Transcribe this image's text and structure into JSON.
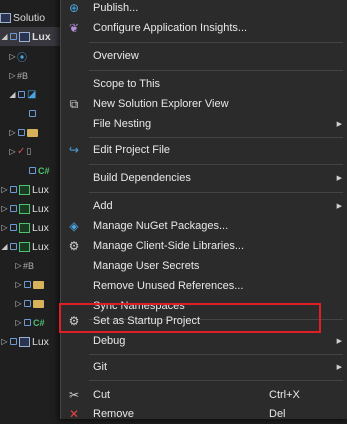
{
  "explorer": {
    "rows": [
      {
        "label": "Solutio"
      },
      {
        "label": "Lux"
      },
      {
        "label": ""
      },
      {
        "label": ""
      },
      {
        "label": ""
      },
      {
        "label": ""
      },
      {
        "label": ""
      },
      {
        "label": ""
      },
      {
        "label": "C#"
      },
      {
        "label": "Lux"
      },
      {
        "label": "Lux"
      },
      {
        "label": "Lux"
      },
      {
        "label": "Lux"
      },
      {
        "label": ""
      },
      {
        "label": ""
      },
      {
        "label": ""
      },
      {
        "label": "C#"
      },
      {
        "label": "Lux"
      }
    ]
  },
  "menu": {
    "items": [
      {
        "label": "Publish...",
        "icon": "globe-icon"
      },
      {
        "label": "Configure Application Insights...",
        "icon": "lightbulb-icon"
      },
      {
        "label": "Overview"
      },
      {
        "label": "Scope to This"
      },
      {
        "label": "New Solution Explorer View",
        "icon": "window-icon"
      },
      {
        "label": "File Nesting"
      },
      {
        "label": "Edit Project File",
        "icon": "edit-arrow-icon"
      },
      {
        "label": "Build Dependencies"
      },
      {
        "label": "Add"
      },
      {
        "label": "Manage NuGet Packages...",
        "icon": "nuget-icon"
      },
      {
        "label": "Manage Client-Side Libraries...",
        "icon": "libraries-icon"
      },
      {
        "label": "Manage User Secrets"
      },
      {
        "label": "Remove Unused References..."
      },
      {
        "label": "Sync Namespaces"
      },
      {
        "label": "Set as Startup Project",
        "icon": "gear-icon"
      },
      {
        "label": "Debug"
      },
      {
        "label": "Git"
      },
      {
        "label": "Cut",
        "icon": "scissors-icon",
        "shortcut": "Ctrl+X"
      },
      {
        "label": "Remove",
        "icon": "close-icon",
        "shortcut": "Del"
      }
    ]
  },
  "colors": {
    "menu_bg": "#2b2b2b",
    "highlight_border": "#e01e26",
    "accent_blue": "#4aa3df"
  }
}
